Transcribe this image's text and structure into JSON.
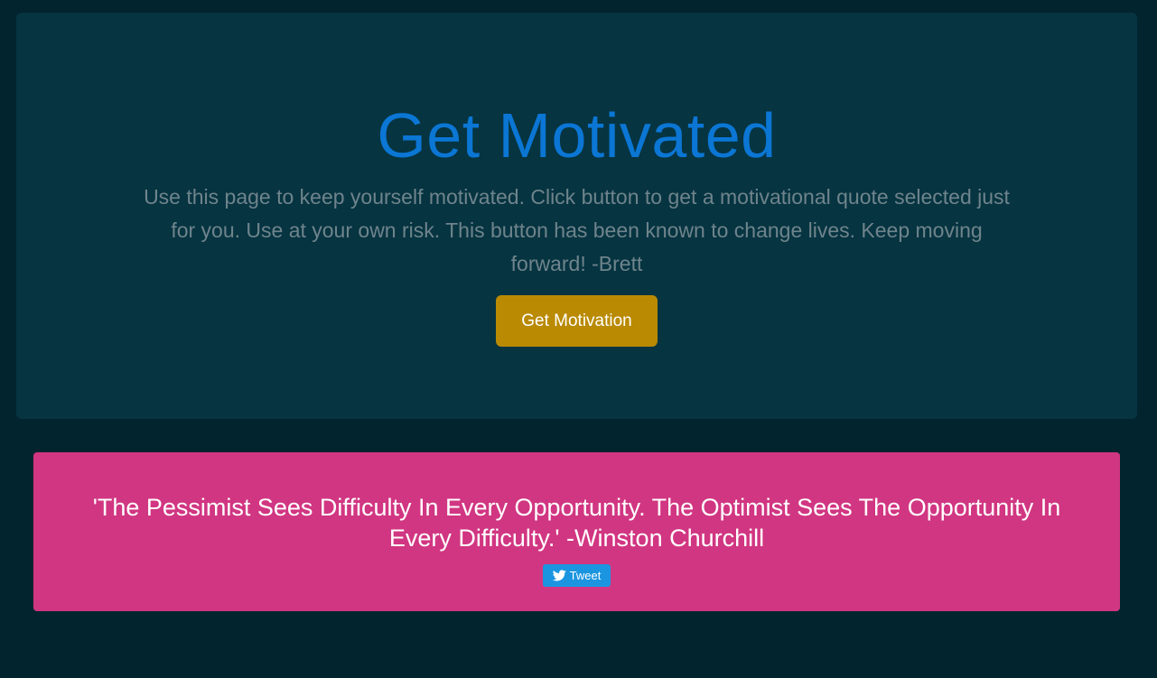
{
  "hero": {
    "title": "Get Motivated",
    "lead": "Use this page to keep yourself motivated. Click button to get a motivational quote selected just for you. Use at your own risk. This button has been known to change lives. Keep moving forward! -Brett",
    "button_label": "Get Motivation"
  },
  "quote": {
    "text": "'The Pessimist Sees Difficulty In Every Opportunity. The Optimist Sees The Opportunity In Every Difficulty.' -Winston Churchill",
    "tweet_label": "Tweet",
    "tweet_icon": "twitter-bird-icon"
  },
  "colors": {
    "background": "#02242f",
    "hero_background": "#063441",
    "title": "#0b76d4",
    "lead_text": "#6f848c",
    "button": "#b98a02",
    "quote_card": "#d13682",
    "tweet_button": "#1b95e0"
  }
}
